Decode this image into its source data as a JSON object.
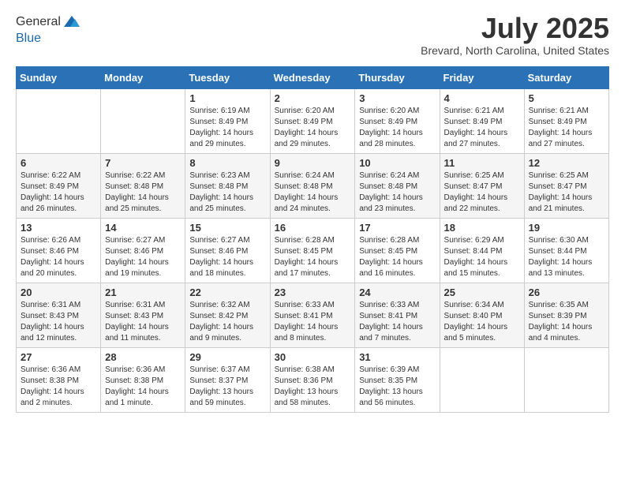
{
  "header": {
    "logo_line1": "General",
    "logo_line2": "Blue",
    "month": "July 2025",
    "location": "Brevard, North Carolina, United States"
  },
  "weekdays": [
    "Sunday",
    "Monday",
    "Tuesday",
    "Wednesday",
    "Thursday",
    "Friday",
    "Saturday"
  ],
  "weeks": [
    [
      {
        "day": "",
        "info": ""
      },
      {
        "day": "",
        "info": ""
      },
      {
        "day": "1",
        "info": "Sunrise: 6:19 AM\nSunset: 8:49 PM\nDaylight: 14 hours and 29 minutes."
      },
      {
        "day": "2",
        "info": "Sunrise: 6:20 AM\nSunset: 8:49 PM\nDaylight: 14 hours and 29 minutes."
      },
      {
        "day": "3",
        "info": "Sunrise: 6:20 AM\nSunset: 8:49 PM\nDaylight: 14 hours and 28 minutes."
      },
      {
        "day": "4",
        "info": "Sunrise: 6:21 AM\nSunset: 8:49 PM\nDaylight: 14 hours and 27 minutes."
      },
      {
        "day": "5",
        "info": "Sunrise: 6:21 AM\nSunset: 8:49 PM\nDaylight: 14 hours and 27 minutes."
      }
    ],
    [
      {
        "day": "6",
        "info": "Sunrise: 6:22 AM\nSunset: 8:49 PM\nDaylight: 14 hours and 26 minutes."
      },
      {
        "day": "7",
        "info": "Sunrise: 6:22 AM\nSunset: 8:48 PM\nDaylight: 14 hours and 25 minutes."
      },
      {
        "day": "8",
        "info": "Sunrise: 6:23 AM\nSunset: 8:48 PM\nDaylight: 14 hours and 25 minutes."
      },
      {
        "day": "9",
        "info": "Sunrise: 6:24 AM\nSunset: 8:48 PM\nDaylight: 14 hours and 24 minutes."
      },
      {
        "day": "10",
        "info": "Sunrise: 6:24 AM\nSunset: 8:48 PM\nDaylight: 14 hours and 23 minutes."
      },
      {
        "day": "11",
        "info": "Sunrise: 6:25 AM\nSunset: 8:47 PM\nDaylight: 14 hours and 22 minutes."
      },
      {
        "day": "12",
        "info": "Sunrise: 6:25 AM\nSunset: 8:47 PM\nDaylight: 14 hours and 21 minutes."
      }
    ],
    [
      {
        "day": "13",
        "info": "Sunrise: 6:26 AM\nSunset: 8:46 PM\nDaylight: 14 hours and 20 minutes."
      },
      {
        "day": "14",
        "info": "Sunrise: 6:27 AM\nSunset: 8:46 PM\nDaylight: 14 hours and 19 minutes."
      },
      {
        "day": "15",
        "info": "Sunrise: 6:27 AM\nSunset: 8:46 PM\nDaylight: 14 hours and 18 minutes."
      },
      {
        "day": "16",
        "info": "Sunrise: 6:28 AM\nSunset: 8:45 PM\nDaylight: 14 hours and 17 minutes."
      },
      {
        "day": "17",
        "info": "Sunrise: 6:28 AM\nSunset: 8:45 PM\nDaylight: 14 hours and 16 minutes."
      },
      {
        "day": "18",
        "info": "Sunrise: 6:29 AM\nSunset: 8:44 PM\nDaylight: 14 hours and 15 minutes."
      },
      {
        "day": "19",
        "info": "Sunrise: 6:30 AM\nSunset: 8:44 PM\nDaylight: 14 hours and 13 minutes."
      }
    ],
    [
      {
        "day": "20",
        "info": "Sunrise: 6:31 AM\nSunset: 8:43 PM\nDaylight: 14 hours and 12 minutes."
      },
      {
        "day": "21",
        "info": "Sunrise: 6:31 AM\nSunset: 8:43 PM\nDaylight: 14 hours and 11 minutes."
      },
      {
        "day": "22",
        "info": "Sunrise: 6:32 AM\nSunset: 8:42 PM\nDaylight: 14 hours and 9 minutes."
      },
      {
        "day": "23",
        "info": "Sunrise: 6:33 AM\nSunset: 8:41 PM\nDaylight: 14 hours and 8 minutes."
      },
      {
        "day": "24",
        "info": "Sunrise: 6:33 AM\nSunset: 8:41 PM\nDaylight: 14 hours and 7 minutes."
      },
      {
        "day": "25",
        "info": "Sunrise: 6:34 AM\nSunset: 8:40 PM\nDaylight: 14 hours and 5 minutes."
      },
      {
        "day": "26",
        "info": "Sunrise: 6:35 AM\nSunset: 8:39 PM\nDaylight: 14 hours and 4 minutes."
      }
    ],
    [
      {
        "day": "27",
        "info": "Sunrise: 6:36 AM\nSunset: 8:38 PM\nDaylight: 14 hours and 2 minutes."
      },
      {
        "day": "28",
        "info": "Sunrise: 6:36 AM\nSunset: 8:38 PM\nDaylight: 14 hours and 1 minute."
      },
      {
        "day": "29",
        "info": "Sunrise: 6:37 AM\nSunset: 8:37 PM\nDaylight: 13 hours and 59 minutes."
      },
      {
        "day": "30",
        "info": "Sunrise: 6:38 AM\nSunset: 8:36 PM\nDaylight: 13 hours and 58 minutes."
      },
      {
        "day": "31",
        "info": "Sunrise: 6:39 AM\nSunset: 8:35 PM\nDaylight: 13 hours and 56 minutes."
      },
      {
        "day": "",
        "info": ""
      },
      {
        "day": "",
        "info": ""
      }
    ]
  ]
}
